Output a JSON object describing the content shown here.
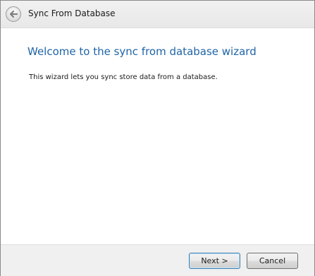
{
  "window": {
    "title": "Sync From Database"
  },
  "header": {
    "back_icon": "back-arrow-icon"
  },
  "main": {
    "heading": "Welcome to the sync from database wizard",
    "description": "This wizard lets you sync store data from a database."
  },
  "footer": {
    "next_label": "Next >",
    "cancel_label": "Cancel"
  },
  "colors": {
    "heading": "#1f64a6",
    "default_button_border": "#3c7fb1",
    "footer_background": "#f0f0f0"
  }
}
